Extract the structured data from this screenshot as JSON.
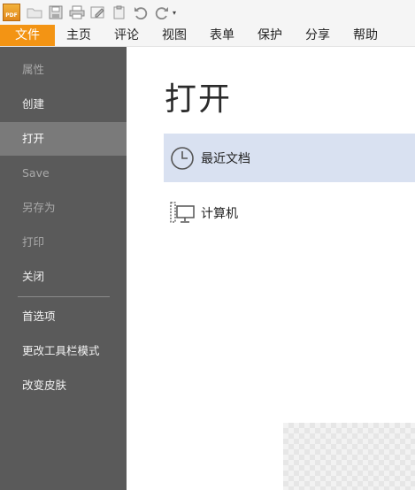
{
  "toolbar": {
    "logo_text": "PDF",
    "icons": [
      "app-logo-icon",
      "open-folder-icon",
      "save-icon",
      "print-icon",
      "edit-icon",
      "paste-icon",
      "undo-icon",
      "redo-icon",
      "customize-dropdown-icon"
    ]
  },
  "menubar": {
    "items": [
      "文件",
      "主页",
      "评论",
      "视图",
      "表单",
      "保护",
      "分享",
      "帮助"
    ],
    "active_color": "#f39414"
  },
  "sidebar": {
    "items": [
      {
        "label": "属性",
        "state": "disabled"
      },
      {
        "label": "创建",
        "state": "normal"
      },
      {
        "label": "打开",
        "state": "active"
      },
      {
        "label": "Save",
        "state": "disabled"
      },
      {
        "label": "另存为",
        "state": "disabled"
      },
      {
        "label": "打印",
        "state": "disabled"
      },
      {
        "label": "关闭",
        "state": "normal"
      },
      {
        "label": "首选项",
        "state": "normal"
      },
      {
        "label": "更改工具栏模式",
        "state": "normal"
      },
      {
        "label": "改变皮肤",
        "state": "normal"
      }
    ],
    "background": "#5a5a5a",
    "active_background": "#7a7a7a"
  },
  "main": {
    "title": "打开",
    "options": [
      {
        "label": "最近文档",
        "icon": "clock-icon",
        "selected": true
      },
      {
        "label": "计算机",
        "icon": "computer-icon",
        "selected": false
      }
    ],
    "selected_color": "#d9e1f1"
  }
}
